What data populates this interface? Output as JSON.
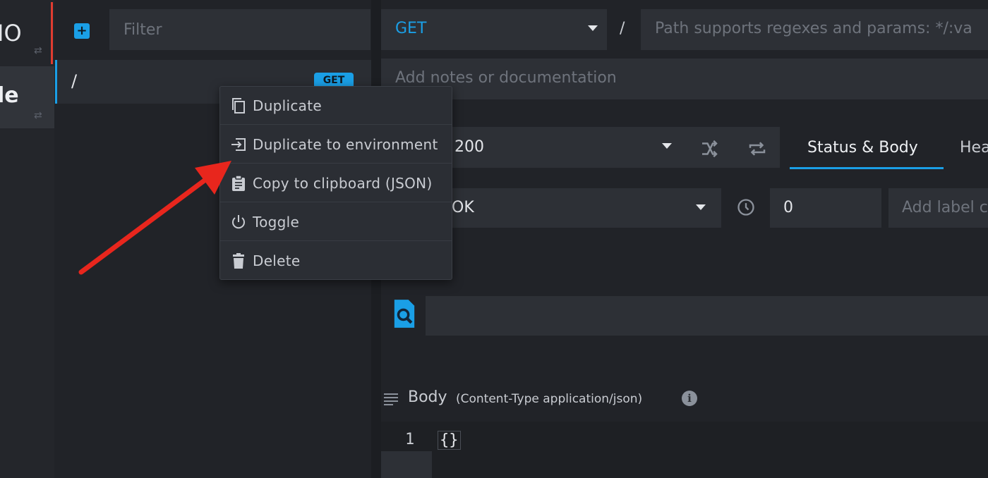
{
  "environments": [
    {
      "name": "IO"
    },
    {
      "name": "le"
    }
  ],
  "routes": {
    "add_button_label": "+",
    "filter_placeholder": "Filter",
    "items": [
      {
        "path": "/",
        "method": "GET"
      }
    ]
  },
  "route_settings": {
    "method": "GET",
    "path_prefix": "/",
    "path_placeholder": "Path supports regexes and params: */:va",
    "notes_placeholder": "Add notes or documentation"
  },
  "response": {
    "status_code": "200",
    "tabs": [
      {
        "label": "Status & Body",
        "active": true
      },
      {
        "label": "Hea",
        "active": false
      }
    ],
    "status_reason": "OK",
    "latency": "0",
    "label_placeholder": "Add label c",
    "body_title": "Body",
    "body_content_type": "(Content-Type application/json)",
    "editor": {
      "line_number": "1",
      "code": "{}"
    }
  },
  "context_menu": {
    "items": [
      {
        "label": "Duplicate",
        "icon": "duplicate-icon"
      },
      {
        "label": "Duplicate to environment",
        "icon": "move-to-environment-icon"
      },
      {
        "label": "Copy to clipboard (JSON)",
        "icon": "clipboard-icon"
      },
      {
        "label": "Toggle",
        "icon": "power-icon"
      },
      {
        "label": "Delete",
        "icon": "trash-icon"
      }
    ]
  },
  "colors": {
    "accent": "#1a9fe6",
    "background": "#212328",
    "field": "#2d3036",
    "annotation_arrow": "#e8261d",
    "env_accent": "#e03c31"
  }
}
